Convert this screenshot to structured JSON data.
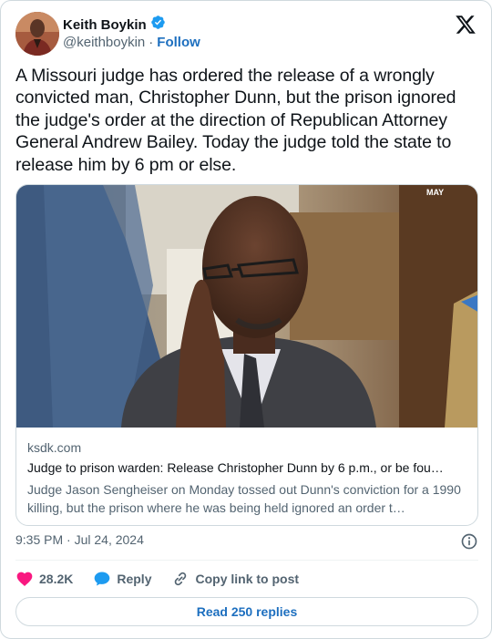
{
  "author": {
    "display_name": "Keith Boykin",
    "handle": "@keithboykin",
    "separator": "·",
    "follow_label": "Follow",
    "verified": true
  },
  "tweet": {
    "text": "A Missouri judge has ordered the release of a wrongly convicted man, Christopher Dunn, but the prison ignored the judge's order at the direction of Republican Attorney General Andrew Bailey. Today the judge told the state to release him by 6 pm or else."
  },
  "link_card": {
    "image_watermark": "MAY",
    "domain": "ksdk.com",
    "title": "Judge to prison warden: Release Christopher Dunn by 6 p.m., or be fou…",
    "description": "Judge Jason Sengheiser on Monday tossed out Dunn's conviction for a 1990 killing, but the prison where he was being held ignored an order t…"
  },
  "meta": {
    "timestamp": "9:35 PM · Jul 24, 2024"
  },
  "actions": {
    "like_count": "28.2K",
    "reply_label": "Reply",
    "copy_link_label": "Copy link to post"
  },
  "read_replies_label": "Read 250 replies",
  "colors": {
    "accent": "#1d9bf0",
    "link_text": "#1d6fbf",
    "like": "#f91880",
    "muted": "#536471",
    "text": "#0f1419",
    "border": "#cfd9de"
  },
  "icons": {
    "verified": "verified-badge-icon",
    "logo": "x-logo-icon",
    "info": "info-icon",
    "like": "heart-icon",
    "reply": "speech-bubble-icon",
    "copy": "link-icon"
  }
}
